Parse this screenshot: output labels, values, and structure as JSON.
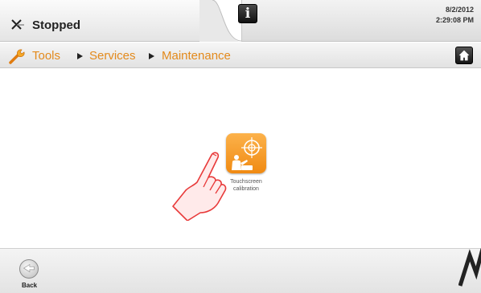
{
  "status": {
    "state_label": "Stopped",
    "stop_icon": "x-close-icon",
    "info_label": "i",
    "date": "8/2/2012",
    "time": "2:29:08 PM"
  },
  "breadcrumb": {
    "icon": "wrench-icon",
    "items": [
      "Tools",
      "Services",
      "Maintenance"
    ],
    "home_icon": "home-icon"
  },
  "content": {
    "tiles": [
      {
        "label_line1": "Touchscreen",
        "label_line2": "calibration",
        "icon": "touchscreen-calibration-icon"
      }
    ]
  },
  "footer": {
    "back_label": "Back",
    "back_icon": "back-arrow-icon"
  },
  "colors": {
    "accent": "#e38a1c",
    "tile_top": "#fcb24b",
    "tile_bottom": "#f08a12",
    "hand": "#e83a3a"
  }
}
